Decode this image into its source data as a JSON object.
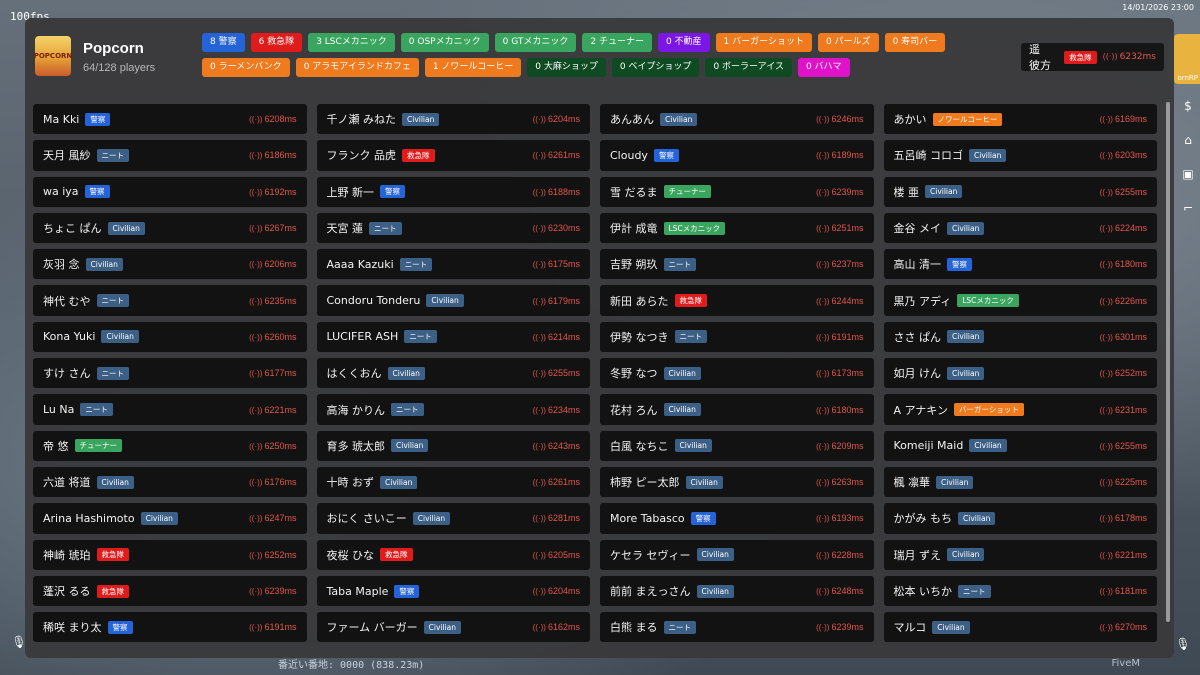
{
  "fps": "100fps",
  "clock": "14/01/2026 23:00",
  "server_right_label": "ornRP",
  "bottom_status": "番近い番地: 0000 (838.23m)",
  "fivem_tag": "FiveM",
  "header": {
    "logo_text": "POPCORN",
    "title": "Popcorn",
    "players": "64/128 players"
  },
  "colors": {
    "police": "#2563d9",
    "ems": "#e01b1b",
    "green": "#3aa55e",
    "purple": "#7b16e6",
    "orange": "#f07a1e",
    "darkgreen": "#0e4a22",
    "magenta": "#e012c9",
    "civilian": "#3c5f86",
    "neet": "#3c5f86",
    "ping": "#e2574c"
  },
  "jobs": [
    {
      "label": "8 警察",
      "color": "police"
    },
    {
      "label": "6 救急隊",
      "color": "ems"
    },
    {
      "label": "3 LSCメカニック",
      "color": "green"
    },
    {
      "label": "0 OSPメカニック",
      "color": "green"
    },
    {
      "label": "0 GTメカニック",
      "color": "green"
    },
    {
      "label": "2 チューナー",
      "color": "green"
    },
    {
      "label": "0 不動産",
      "color": "purple"
    },
    {
      "label": "1 バーガーショット",
      "color": "orange"
    },
    {
      "label": "0 パールズ",
      "color": "orange"
    },
    {
      "label": "0 寿司バー",
      "color": "orange"
    },
    {
      "label": "0 ラーメンバンク",
      "color": "orange"
    },
    {
      "label": "0 アラモアイランドカフェ",
      "color": "orange"
    },
    {
      "label": "1 ノワールコーヒー",
      "color": "orange"
    },
    {
      "label": "0 大麻ショップ",
      "color": "darkgreen"
    },
    {
      "label": "0 ベイプショップ",
      "color": "darkgreen"
    },
    {
      "label": "0 ボーラーアイス",
      "color": "darkgreen"
    },
    {
      "label": "0 バハマ",
      "color": "magenta"
    }
  ],
  "self": {
    "name": "遥 彼方",
    "badge": "救急隊",
    "badge_color": "ems",
    "ping": "6232ms"
  },
  "players": [
    {
      "name": "Ma Kki",
      "badge": "警察",
      "color": "police",
      "ping": "6208ms"
    },
    {
      "name": "千ノ瀬 みねた",
      "badge": "Civilian",
      "color": "civilian",
      "ping": "6204ms"
    },
    {
      "name": "あんあん",
      "badge": "Civilian",
      "color": "civilian",
      "ping": "6246ms"
    },
    {
      "name": "あかい",
      "badge": "ノワールコーヒー",
      "color": "orange",
      "ping": "6169ms"
    },
    {
      "name": "天月 風紗",
      "badge": "ニート",
      "color": "neet",
      "ping": "6186ms"
    },
    {
      "name": "フランク 品虎",
      "badge": "救急隊",
      "color": "ems",
      "ping": "6261ms"
    },
    {
      "name": "Cloudy",
      "badge": "警察",
      "color": "police",
      "ping": "6189ms"
    },
    {
      "name": "五呂崎 コロゴ",
      "badge": "Civilian",
      "color": "civilian",
      "ping": "6203ms"
    },
    {
      "name": "wa iya",
      "badge": "警察",
      "color": "police",
      "ping": "6192ms"
    },
    {
      "name": "上野 新一",
      "badge": "警察",
      "color": "police",
      "ping": "6188ms"
    },
    {
      "name": "雪 だるま",
      "badge": "チューナー",
      "color": "green",
      "ping": "6239ms"
    },
    {
      "name": "楼 亜",
      "badge": "Civilian",
      "color": "civilian",
      "ping": "6255ms"
    },
    {
      "name": "ちょこ ぱん",
      "badge": "Civilian",
      "color": "civilian",
      "ping": "6267ms"
    },
    {
      "name": "天宮 蓮",
      "badge": "ニート",
      "color": "neet",
      "ping": "6230ms"
    },
    {
      "name": "伊計 成竜",
      "badge": "LSCメカニック",
      "color": "green",
      "ping": "6251ms"
    },
    {
      "name": "金谷 メイ",
      "badge": "Civilian",
      "color": "civilian",
      "ping": "6224ms"
    },
    {
      "name": "灰羽 念",
      "badge": "Civilian",
      "color": "civilian",
      "ping": "6206ms"
    },
    {
      "name": "Aaaa Kazuki",
      "badge": "ニート",
      "color": "neet",
      "ping": "6175ms"
    },
    {
      "name": "吉野 朔玖",
      "badge": "ニート",
      "color": "neet",
      "ping": "6237ms"
    },
    {
      "name": "高山 清一",
      "badge": "警察",
      "color": "police",
      "ping": "6180ms"
    },
    {
      "name": "神代 むや",
      "badge": "ニート",
      "color": "neet",
      "ping": "6235ms"
    },
    {
      "name": "Condoru Tonderu",
      "badge": "Civilian",
      "color": "civilian",
      "ping": "6179ms"
    },
    {
      "name": "新田 あらた",
      "badge": "救急隊",
      "color": "ems",
      "ping": "6244ms"
    },
    {
      "name": "黒乃 アディ",
      "badge": "LSCメカニック",
      "color": "green",
      "ping": "6226ms"
    },
    {
      "name": "Kona Yuki",
      "badge": "Civilian",
      "color": "civilian",
      "ping": "6260ms"
    },
    {
      "name": "LUCIFER ASH",
      "badge": "ニート",
      "color": "neet",
      "ping": "6214ms"
    },
    {
      "name": "伊勢 なつき",
      "badge": "ニート",
      "color": "neet",
      "ping": "6191ms"
    },
    {
      "name": "ささ ぱん",
      "badge": "Civilian",
      "color": "civilian",
      "ping": "6301ms"
    },
    {
      "name": "すけ さん",
      "badge": "ニート",
      "color": "neet",
      "ping": "6177ms"
    },
    {
      "name": "はくくおん",
      "badge": "Civilian",
      "color": "civilian",
      "ping": "6255ms"
    },
    {
      "name": "冬野 なつ",
      "badge": "Civilian",
      "color": "civilian",
      "ping": "6173ms"
    },
    {
      "name": "如月 けん",
      "badge": "Civilian",
      "color": "civilian",
      "ping": "6252ms"
    },
    {
      "name": "Lu Na",
      "badge": "ニート",
      "color": "neet",
      "ping": "6221ms"
    },
    {
      "name": "高海 かりん",
      "badge": "ニート",
      "color": "neet",
      "ping": "6234ms"
    },
    {
      "name": "花村 ろん",
      "badge": "Civilian",
      "color": "civilian",
      "ping": "6180ms"
    },
    {
      "name": "A アナキン",
      "badge": "バーガーショット",
      "color": "orange",
      "ping": "6231ms"
    },
    {
      "name": "帝 悠",
      "badge": "チューナー",
      "color": "green",
      "ping": "6250ms"
    },
    {
      "name": "育多 琥太郎",
      "badge": "Civilian",
      "color": "civilian",
      "ping": "6243ms"
    },
    {
      "name": "白風 なちこ",
      "badge": "Civilian",
      "color": "civilian",
      "ping": "6209ms"
    },
    {
      "name": "Komeiji Maid",
      "badge": "Civilian",
      "color": "civilian",
      "ping": "6255ms"
    },
    {
      "name": "六道 将道",
      "badge": "Civilian",
      "color": "civilian",
      "ping": "6176ms"
    },
    {
      "name": "十時 おず",
      "badge": "Civilian",
      "color": "civilian",
      "ping": "6261ms"
    },
    {
      "name": "柿野 ピー太郎",
      "badge": "Civilian",
      "color": "civilian",
      "ping": "6263ms"
    },
    {
      "name": "楓 凛華",
      "badge": "Civilian",
      "color": "civilian",
      "ping": "6225ms"
    },
    {
      "name": "Arina Hashimoto",
      "badge": "Civilian",
      "color": "civilian",
      "ping": "6247ms"
    },
    {
      "name": "おにく さいこー",
      "badge": "Civilian",
      "color": "civilian",
      "ping": "6281ms"
    },
    {
      "name": "More Tabasco",
      "badge": "警察",
      "color": "police",
      "ping": "6193ms"
    },
    {
      "name": "かがみ もち",
      "badge": "Civilian",
      "color": "civilian",
      "ping": "6178ms"
    },
    {
      "name": "神崎 琥珀",
      "badge": "救急隊",
      "color": "ems",
      "ping": "6252ms"
    },
    {
      "name": "夜桜 ひな",
      "badge": "救急隊",
      "color": "ems",
      "ping": "6205ms"
    },
    {
      "name": "ケセラ セヴィー",
      "badge": "Civilian",
      "color": "civilian",
      "ping": "6228ms"
    },
    {
      "name": "瑞月 ずえ",
      "badge": "Civilian",
      "color": "civilian",
      "ping": "6221ms"
    },
    {
      "name": "蓬沢 るる",
      "badge": "救急隊",
      "color": "ems",
      "ping": "6239ms"
    },
    {
      "name": "Taba Maple",
      "badge": "警察",
      "color": "police",
      "ping": "6204ms"
    },
    {
      "name": "前前 まえっさん",
      "badge": "Civilian",
      "color": "civilian",
      "ping": "6248ms"
    },
    {
      "name": "松本 いちか",
      "badge": "ニート",
      "color": "neet",
      "ping": "6181ms"
    },
    {
      "name": "稀咲 まり太",
      "badge": "警察",
      "color": "police",
      "ping": "6191ms"
    },
    {
      "name": "ファーム バーガー",
      "badge": "Civilian",
      "color": "civilian",
      "ping": "6162ms"
    },
    {
      "name": "白熊 まる",
      "badge": "ニート",
      "color": "neet",
      "ping": "6239ms"
    },
    {
      "name": "マルコ",
      "badge": "Civilian",
      "color": "civilian",
      "ping": "6270ms"
    }
  ]
}
